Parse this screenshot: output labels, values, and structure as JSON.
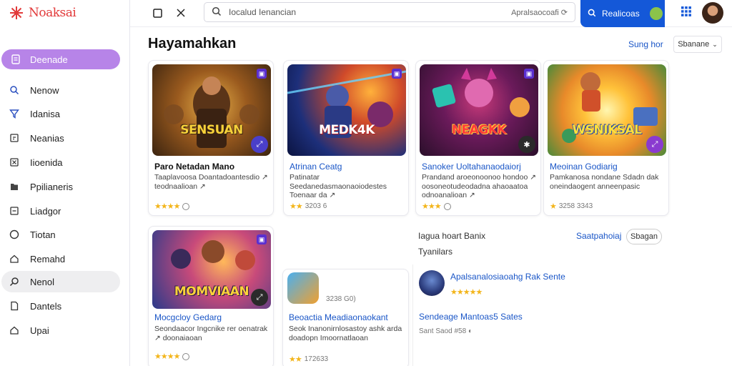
{
  "app": {
    "logo_text": "Noaksai"
  },
  "sidebar": {
    "items": [
      {
        "label": "Deenade",
        "icon": "document-icon",
        "active": true
      },
      {
        "label": "Nenow",
        "icon": "search-icon"
      },
      {
        "label": "Idanisa",
        "icon": "filter-icon"
      },
      {
        "label": "Neanias",
        "icon": "bookmark-icon"
      },
      {
        "label": "Iioenida",
        "icon": "close-box-icon"
      },
      {
        "label": "Ppilianeris",
        "icon": "folder-icon"
      },
      {
        "label": "Liadgor",
        "icon": "inbox-icon"
      },
      {
        "label": "Tiotan",
        "icon": "circle-icon"
      },
      {
        "label": "Remahd",
        "icon": "home-icon"
      },
      {
        "label": "Nenol",
        "icon": "search-icon",
        "highlighted": true
      },
      {
        "label": "Dantels",
        "icon": "document-icon"
      },
      {
        "label": "Upai",
        "icon": "home-icon"
      }
    ]
  },
  "topbar": {
    "search_text": "Iocalud Ienancian",
    "search_hint": "Apralsaocoafi ⟳",
    "blue_button": "Realicoas",
    "blue_button_icon": "search-icon"
  },
  "main": {
    "heading": "Hayamahkan",
    "top_link": "Sung hor",
    "sort_label": "Sbanane",
    "cards": [
      {
        "art": "SENSUAN",
        "title": "Paro Netadan Mano",
        "title_style": "dark",
        "desc": "Taaplavoosa Doantadoantesdio ↗ teodnaalioan ↗",
        "meta": "★★★★ ◐",
        "stars": "★★★★"
      },
      {
        "art": "MEDK4K",
        "title": "Atrinan Ceatg",
        "title_style": "blue",
        "desc": "Patinatar Seedanedasmaonaoiodestes Toenaar da ↗",
        "meta": "★★ 3203 6",
        "stars": "★★"
      },
      {
        "art": "NEAGKK",
        "title": "Sanoker Uoltahanaodaiorj",
        "title_style": "blue",
        "desc": "Prandand aroeonoonoo hondoo ↗ oosoneotudeodadna ahaoaatoa odnoanalioan ↗",
        "meta": "★★★ ◐",
        "stars": "★★★"
      },
      {
        "art": "WSNIKSAL",
        "title": "Meoinan Godiarig",
        "title_style": "blue",
        "desc": "Pamkanosa nondane Sdadn dak oneindaogent anneenpasic",
        "meta": "★ 3258 3343",
        "stars": "★"
      },
      {
        "art": "MOMVIAAN",
        "title": "Mocgcloy Gedarg",
        "title_style": "blue",
        "desc": "Seondaacor Ingcnike rer oenatrak ↗ doonaiaoan",
        "meta": "★★★★ ◐",
        "stars": "★★★★"
      }
    ],
    "app_item": {
      "title": "Beoactia Meadiaonaokant",
      "desc": "Seok Inanonirnlosastoy ashk arda doadopn Imoornatlaoan",
      "meta": "★★ 172633",
      "stars": "★★",
      "aside": "3238 G0)"
    },
    "section": {
      "title": "Iagua hoart Banix",
      "subtitle": "Tyanilars",
      "link": "Saatpahoiaj",
      "pill": "Sbagan"
    },
    "featured": {
      "title": "Apalsanalosiaoahg Rak Sente",
      "stars": "★★★★★",
      "subtitle": "Sendeage Mantoas5 Sates",
      "meta": "Sant Saod #58 ◐"
    }
  },
  "colors": {
    "accent": "#b784e8",
    "primary": "#1458d8",
    "star": "#f3b51b",
    "link": "#1a56c7"
  }
}
